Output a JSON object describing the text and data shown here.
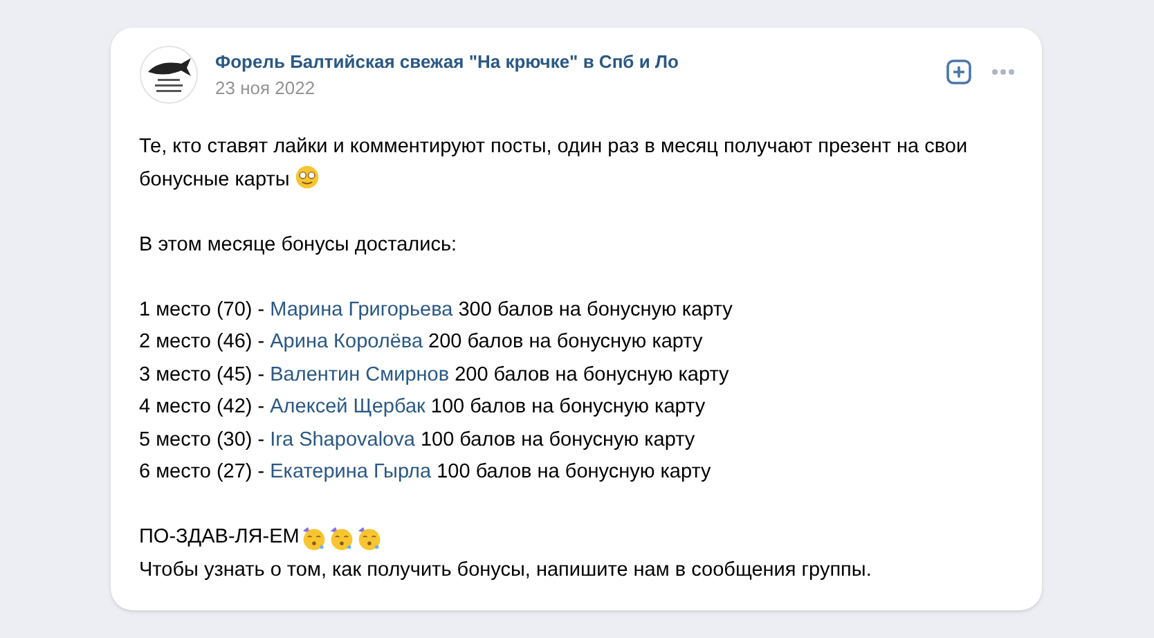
{
  "post": {
    "author": "Форель Балтийская свежая \"На крючке\" в Спб и Ло",
    "date": "23 ноя 2022",
    "intro": {
      "text": "Те, кто ставят лайки и комментируют посты, один раз в месяц получают презент на свои бонусные карты",
      "emojis": [
        {
          "kind": "glasses-face"
        }
      ]
    },
    "heading": "В этом месяце бонусы достались:",
    "winners": [
      {
        "place": "1 место (70) - ",
        "name": "Марина Григорьева",
        "prize": " 300 балов на бонусную карту"
      },
      {
        "place": "2 место (46) - ",
        "name": "Арина Королёва",
        "prize": " 200 балов на бонусную карту"
      },
      {
        "place": "3 место (45) - ",
        "name": "Валентин Смирнов",
        "prize": " 200 балов на бонусную карту"
      },
      {
        "place": "4 место (42) - ",
        "name": "Алексей Щербак",
        "prize": " 100 балов на бонусную карту"
      },
      {
        "place": "5 место (30) - ",
        "name": "Ira Shapovalova",
        "prize": " 100 балов на бонусную карту"
      },
      {
        "place": "6 место (27) - ",
        "name": "Екатерина Гырла",
        "prize": " 100 балов на бонусную карту"
      }
    ],
    "congrats": {
      "text": "ПО-ЗДАВ-ЛЯ-ЕМ",
      "emojis": [
        {
          "kind": "party-face"
        },
        {
          "kind": "party-face"
        },
        {
          "kind": "party-face"
        }
      ]
    },
    "footer": "Чтобы узнать о том, как получить бонусы, напишите нам в сообщения группы."
  }
}
